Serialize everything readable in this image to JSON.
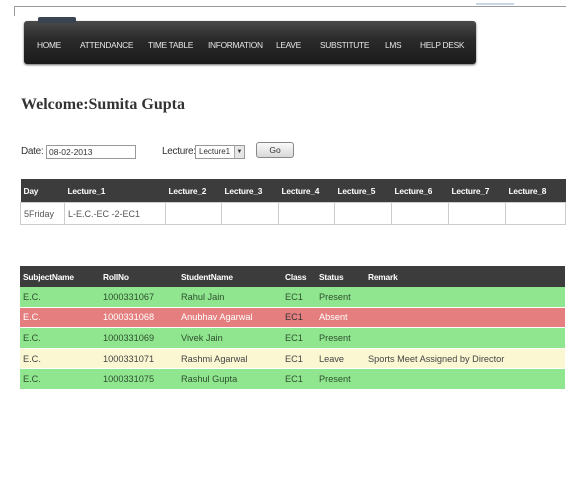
{
  "nav": {
    "items": [
      {
        "label": "HOME"
      },
      {
        "label": "ATTENDANCE"
      },
      {
        "label": "TIME TABLE"
      },
      {
        "label": "INFORMATION"
      },
      {
        "label": "LEAVE"
      },
      {
        "label": "SUBSTITUTE"
      },
      {
        "label": "LMS"
      },
      {
        "label": "HELP DESK"
      }
    ]
  },
  "welcome": "Welcome:Sumita Gupta",
  "form": {
    "date_label": "Date:",
    "date_value": "08-02-2013",
    "lecture_label": "Lecture:",
    "lecture_value": "Lecture1",
    "go_label": "Go"
  },
  "lecture_table": {
    "headers": [
      "Day",
      "Lecture_1",
      "Lecture_2",
      "Lecture_3",
      "Lecture_4",
      "Lecture_5",
      "Lecture_6",
      "Lecture_7",
      "Lecture_8"
    ],
    "row": [
      "5Friday",
      "L-E.C.-EC -2-EC1",
      "",
      "",
      "",
      "",
      "",
      "",
      ""
    ]
  },
  "attendance_table": {
    "headers": [
      "SubjectName",
      "RollNo",
      "StudentName",
      "Class",
      "Status",
      "Remark"
    ],
    "rows": [
      {
        "subject": "E.C.",
        "roll": "1000331067",
        "name": "Rahul Jain",
        "class": "EC1",
        "status": "Present",
        "remark": ""
      },
      {
        "subject": "E.C.",
        "roll": "1000331068",
        "name": "Anubhav Agarwal",
        "class": "EC1",
        "status": "Absent",
        "remark": ""
      },
      {
        "subject": "E.C.",
        "roll": "1000331069",
        "name": "Vivek Jain",
        "class": "EC1",
        "status": "Present",
        "remark": ""
      },
      {
        "subject": "E.C.",
        "roll": "1000331071",
        "name": "Rashmi Agarwal",
        "class": "EC1",
        "status": "Leave",
        "remark": "Sports Meet Assigned by Director"
      },
      {
        "subject": "E.C.",
        "roll": "1000331075",
        "name": "Rashul Gupta",
        "class": "EC1",
        "status": "Present",
        "remark": ""
      }
    ],
    "status_colors": {
      "Present": "#8fe68f",
      "Absent": "#e57f7f",
      "Leave": "#fbf7d2"
    }
  }
}
